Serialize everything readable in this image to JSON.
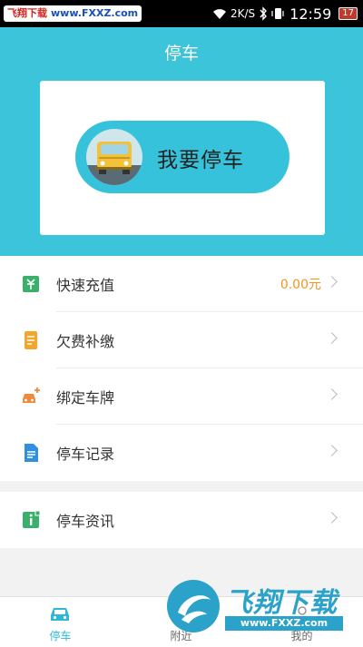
{
  "status_bar": {
    "watermark_left": "飞翔下载",
    "watermark_url": "www.FXXZ.com",
    "network_speed": "2K/S",
    "time": "12:59",
    "battery": "17"
  },
  "header": {
    "title": "停车",
    "park_button_label": "我要停车",
    "accent_color": "#3cc4da"
  },
  "menu": [
    {
      "label": "快速充值",
      "value": "0.00元",
      "icon": "wallet-icon"
    },
    {
      "label": "欠费补缴",
      "icon": "receipt-icon"
    },
    {
      "label": "绑定车牌",
      "icon": "car-plus-icon"
    },
    {
      "label": "停车记录",
      "icon": "document-icon"
    }
  ],
  "menu2": [
    {
      "label": "停车资讯",
      "icon": "info-icon"
    }
  ],
  "tabs": [
    {
      "label": "停车",
      "icon": "car-icon",
      "active": true
    },
    {
      "label": "附近",
      "icon": "location-icon",
      "active": false
    },
    {
      "label": "我的",
      "icon": "person-icon",
      "active": false
    }
  ],
  "watermark": {
    "text": "飞翔下载",
    "url": "www.FXXZ.com"
  }
}
